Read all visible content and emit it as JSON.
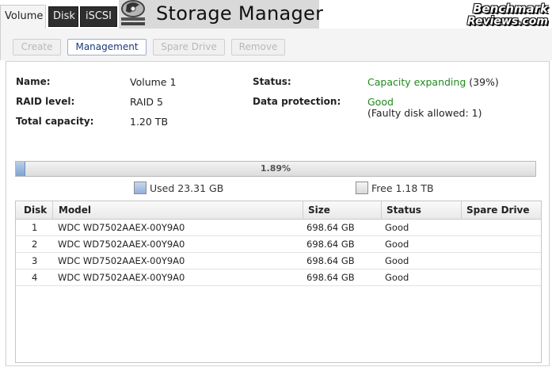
{
  "tabs": [
    {
      "label": "Volume",
      "active": true
    },
    {
      "label": "Disk",
      "active": false
    },
    {
      "label": "iSCSI",
      "active": false
    }
  ],
  "app_title": "Storage Manager",
  "app_icon": "storage-manager-icon",
  "watermark": {
    "line1": "Benchmark",
    "line2": "Reviews.com"
  },
  "toolbar": {
    "create_label": "Create",
    "management_label": "Management",
    "spare_drive_label": "Spare Drive",
    "remove_label": "Remove"
  },
  "volume": {
    "name_label": "Name:",
    "name_value": "Volume 1",
    "raid_label": "RAID level:",
    "raid_value": "RAID 5",
    "capacity_label": "Total capacity:",
    "capacity_value": "1.20 TB",
    "status_label": "Status:",
    "status_value": "Capacity expanding",
    "status_progress": "(39%)",
    "protection_label": "Data protection:",
    "protection_value": "Good",
    "protection_note": "(Faulty disk allowed: 1)"
  },
  "usage": {
    "used_fraction": 0.0189,
    "percent_label": "1.89%",
    "used_legend": "Used 23.31 GB",
    "free_legend": "Free 1.18 TB"
  },
  "colors": {
    "status_green": "#1f8a1f",
    "used_blue": "#8fb1d9"
  },
  "disk_table": {
    "headers": [
      "Disk",
      "Model",
      "Size",
      "Status",
      "Spare Drive"
    ],
    "rows": [
      {
        "disk": "1",
        "model": "WDC WD7502AAEX-00Y9A0",
        "size": "698.64 GB",
        "status": "Good",
        "spare": ""
      },
      {
        "disk": "2",
        "model": "WDC WD7502AAEX-00Y9A0",
        "size": "698.64 GB",
        "status": "Good",
        "spare": ""
      },
      {
        "disk": "3",
        "model": "WDC WD7502AAEX-00Y9A0",
        "size": "698.64 GB",
        "status": "Good",
        "spare": ""
      },
      {
        "disk": "4",
        "model": "WDC WD7502AAEX-00Y9A0",
        "size": "698.64 GB",
        "status": "Good",
        "spare": ""
      }
    ]
  }
}
